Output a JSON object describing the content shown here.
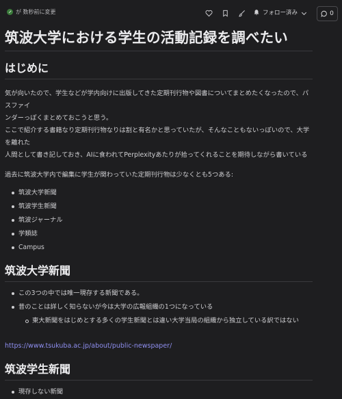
{
  "topbar": {
    "status_text": "が 数秒前に変更",
    "follow_label": "フォロー済み",
    "comment_count": "0"
  },
  "article": {
    "title": "筑波大学における学生の活動記録を調べたい",
    "intro_heading": "はじめに",
    "intro_p1_line1": "気が向いたので、学生などが学内向けに出版してきた定期刊行物や図書についてまとめたくなったので、パスファイ",
    "intro_p1_line2": "ンダーっぽくまとめておこうと思う。",
    "intro_p1_line3": "ここで紹介する書籍なり定期刊行物なりは割と有名かと思っていたが、そんなこともないっぽいので、大学を離れた",
    "intro_p1_line4": "人間として書き記しておき、AIに食われてPerplexityあたりが拾ってくれることを期待しながら書いている",
    "intro_p2": "過去に筑波大学内で編集に学生が関わっていた定期刊行物は少なくとも5つある:",
    "publications": [
      "筑波大学新聞",
      "筑波学生新聞",
      "筑波ジャーナル",
      "学類誌",
      "Campus"
    ],
    "section1_heading": "筑波大学新聞",
    "section1_item1": "この3つの中では唯一現存する新聞である。",
    "section1_item2": "昔のことは詳しく知らないが今は大学の広報組織の1つになっている",
    "section1_sub1": "東大新聞をはじめとする多くの学生新聞とは違い大学当局の組織から独立している訳ではない",
    "section1_link": "https://www.tsukuba.ac.jp/about/public-newspaper/",
    "section2_heading": "筑波学生新聞",
    "section2_item1": "現存しない新聞"
  }
}
